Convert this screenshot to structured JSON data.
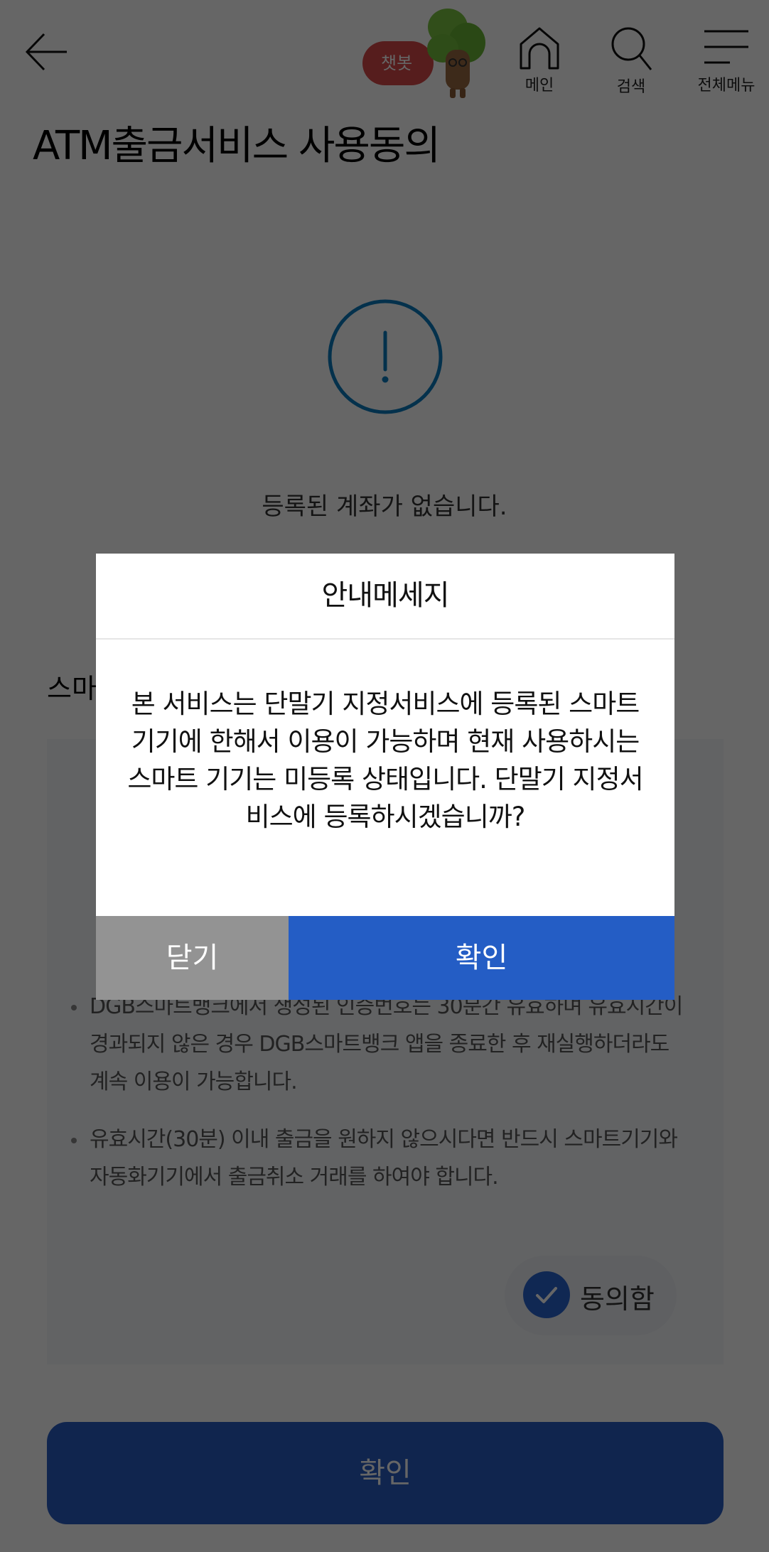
{
  "header": {
    "back_label": "뒤로",
    "chatbot_label": "챗봇",
    "nav": [
      {
        "icon": "home-icon",
        "label": "메인"
      },
      {
        "icon": "search-icon",
        "label": "검색"
      },
      {
        "icon": "menu-icon",
        "label": "전체메뉴"
      }
    ]
  },
  "page": {
    "title": "ATM출금서비스 사용동의",
    "alert_icon": "exclamation-circle-icon",
    "no_account_message": "등록된 계좌가 없습니다.",
    "section_title_partial": "스마",
    "notices": [
      "DGB스마트뱅크에서 생성된 인증번호는 30분간 유효하며 유효시간이 경과되지 않은 경우 DGB스마트뱅크 앱을 종료한 후 재실행하더라도 계속 이용이 가능합니다.",
      "유효시간(30분) 이내 출금을 원하지 않으시다면 반드시 스마트기기와 자동화기기에서 출금취소 거래를 하여야 합니다."
    ],
    "agree_label": "동의함",
    "agree_checked": true,
    "confirm_label": "확인"
  },
  "modal": {
    "title": "안내메세지",
    "message": "본 서비스는 단말기 지정서비스에 등록된 스마트 기기에 한해서 이용이 가능하며 현재 사용하시는 스마트 기기는 미등록 상태입니다. 단말기 지정서비스에 등록하시겠습니까?",
    "close_label": "닫기",
    "ok_label": "확인"
  },
  "colors": {
    "primary": "#245dc5",
    "close_button": "#939393",
    "alert_icon": "#0a7bbf",
    "chatbot": "#d84a4a",
    "overlay": "rgba(0,0,0,0.6)"
  }
}
